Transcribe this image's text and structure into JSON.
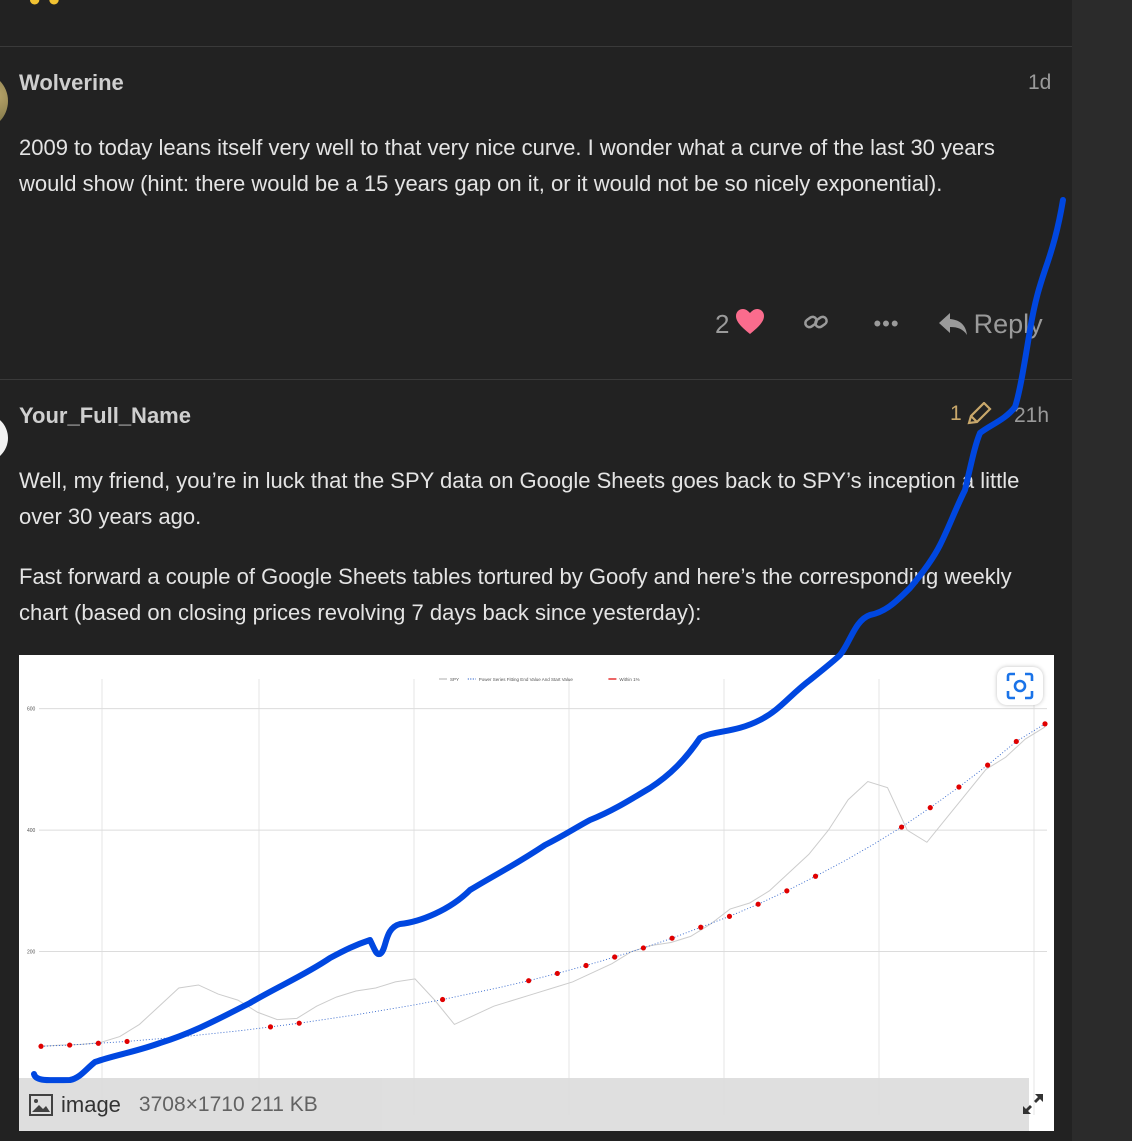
{
  "post1": {
    "username": "Wolverine",
    "time": "1d",
    "body": [
      "2009 to today leans itself very well to that very nice curve. I wonder what a curve of the last 30 years would show (hint: there would be a 15 years gap on it, or it would not be so nicely exponential)."
    ],
    "like_count": "2",
    "reply_label": "Reply"
  },
  "post2": {
    "username": "Your_Full_Name",
    "edit_count": "1",
    "time": "21h",
    "body": [
      "Well, my friend, you’re in luck that the SPY data on Google Sheets goes back to SPY’s inception a little over 30 years ago.",
      "Fast forward a couple of Google Sheets tables tortured by Goofy and here’s the corresponding weekly chart (based on closing prices revolving 7 days back since yesterday):"
    ]
  },
  "image_meta": {
    "label": "image",
    "dimensions": "3708×1710 211 KB"
  },
  "colors": {
    "background": "#222222",
    "accent_heart": "#fa6c8d",
    "edit": "#c9a86b",
    "annotation": "#0047e0",
    "red_points": "#e00000"
  },
  "icons": {
    "heart": "heart-icon",
    "link": "link-icon",
    "more": "more-icon",
    "reply": "reply-icon",
    "pencil": "pencil-icon",
    "lens": "visual-search-icon",
    "image": "image-icon",
    "expand": "expand-icon"
  },
  "chart_data": {
    "type": "line",
    "title": "",
    "series": [
      {
        "name": "SPY"
      },
      {
        "name": "Power Series Fitting End Value And Start Value"
      },
      {
        "name": "Within 1%"
      }
    ],
    "y_ticks": [
      "600",
      "400",
      "200"
    ],
    "ylim": [
      0,
      600
    ],
    "grid": true,
    "legend": "top-center",
    "spy_values": [
      44,
      46,
      47,
      50,
      60,
      80,
      110,
      140,
      145,
      130,
      120,
      100,
      88,
      90,
      110,
      125,
      135,
      140,
      150,
      155,
      120,
      80,
      95,
      110,
      120,
      130,
      140,
      150,
      165,
      180,
      200,
      210,
      215,
      225,
      245,
      270,
      280,
      300,
      330,
      360,
      400,
      450,
      480,
      470,
      400,
      380,
      420,
      460,
      500,
      520,
      550,
      570
    ],
    "fit_values": [
      44,
      46,
      49,
      52,
      56,
      60,
      65,
      70,
      76,
      82,
      89,
      96,
      104,
      112,
      121,
      131,
      141,
      152,
      164,
      177,
      191,
      206,
      222,
      240,
      258,
      278,
      300,
      324,
      349,
      376,
      405,
      437,
      471,
      507,
      546,
      575
    ]
  },
  "annotation": {
    "description": "hand-drawn blue curve overlay"
  }
}
